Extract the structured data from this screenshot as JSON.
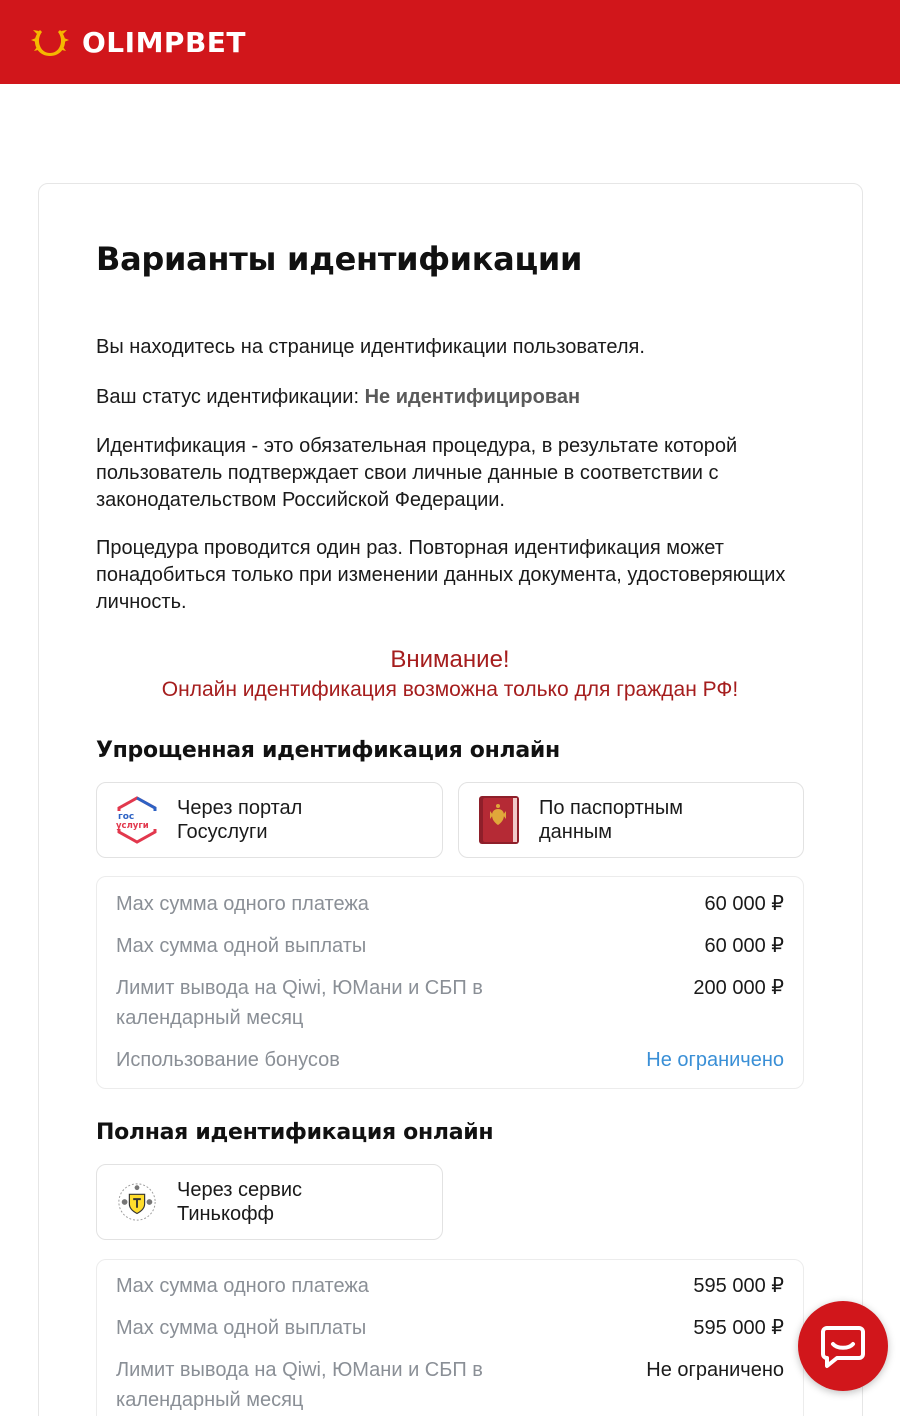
{
  "header": {
    "brand": "OLIMPBET",
    "bg_color": "#d1161b",
    "logo_icon": "laurel-wreath-icon"
  },
  "page": {
    "title": "Варианты идентификации",
    "intro": "Вы находитесь на странице идентификации пользователя.",
    "status_label": "Ваш статус идентификации: ",
    "status_value": "Не идентифицирован",
    "description": "Идентификация - это обязательная процедура, в результате которой пользователь подтверждает свои личные данные в соответствии с законодательством Российской Федерации.",
    "procedure": "Процедура проводится один раз. Повторная идентификация может понадобиться только при изменении данных документа, удостоверяющих личность.",
    "warning_title": "Внимание!",
    "warning_text": "Онлайн идентификация возможна только для граждан РФ!"
  },
  "simplified": {
    "title": "Упрощенная идентификация онлайн",
    "methods": [
      {
        "label": "Через портал Госуслуги",
        "icon": "gosuslugi-icon",
        "icon_text_top": "гос",
        "icon_text_bottom": "услуги"
      },
      {
        "label": "По паспортным данным",
        "icon": "passport-icon"
      }
    ],
    "limits": [
      {
        "label": "Max сумма одного платежа",
        "value": "60 000 ₽"
      },
      {
        "label": "Max сумма одной выплаты",
        "value": "60 000 ₽"
      },
      {
        "label": "Лимит вывода на Qiwi, ЮМани и СБП в календарный месяц",
        "value": "200 000 ₽"
      },
      {
        "label": "Использование бонусов",
        "value": "Не ограничено"
      }
    ]
  },
  "full": {
    "title": "Полная идентификация онлайн",
    "methods": [
      {
        "label": "Через сервис Тинькофф",
        "icon": "tinkoff-icon"
      }
    ],
    "limits": [
      {
        "label": "Max сумма одного платежа",
        "value": "595 000 ₽"
      },
      {
        "label": "Max сумма одной выплаты",
        "value": "595 000 ₽"
      },
      {
        "label": "Лимит вывода на Qiwi, ЮМани и СБП в календарный месяц",
        "value": "Не ограничено"
      }
    ]
  },
  "chat": {
    "icon": "chat-bubble-icon"
  }
}
